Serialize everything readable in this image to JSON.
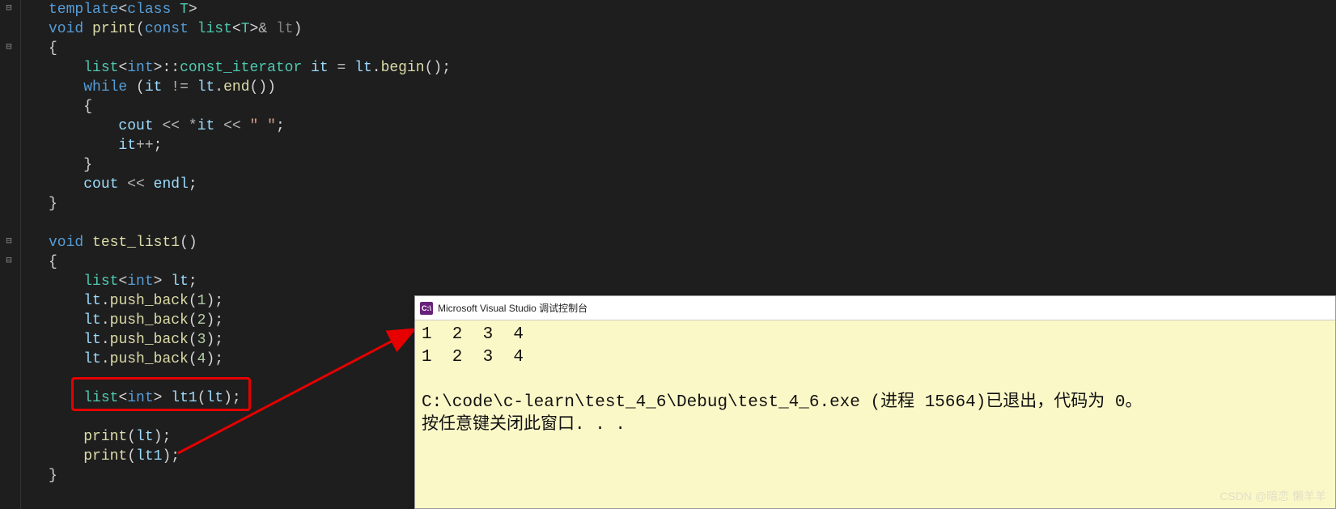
{
  "code": {
    "l1": "template<class T>",
    "l2": "void print(const list<T>& lt)",
    "l3": "{",
    "l4": "    list<int>::const_iterator it = lt.begin();",
    "l5": "    while (it != lt.end())",
    "l6": "    {",
    "l7": "        cout << *it << \" \";",
    "l8": "        it++;",
    "l9": "    }",
    "l10": "    cout << endl;",
    "l11": "}",
    "l12": "",
    "l13": "void test_list1()",
    "l14": "{",
    "l15": "    list<int> lt;",
    "l16": "    lt.push_back(1);",
    "l17": "    lt.push_back(2);",
    "l18": "    lt.push_back(3);",
    "l19": "    lt.push_back(4);",
    "l20": "",
    "l21": "    list<int> lt1(lt);",
    "l22": "",
    "l23": "    print(lt);",
    "l24": "    print(lt1);",
    "l25": "}"
  },
  "console": {
    "title": "Microsoft Visual Studio 调试控制台",
    "icon_text": "C:\\",
    "out1": "1  2  3  4",
    "out2": "1  2  3  4",
    "blank": "",
    "exit": "C:\\code\\c-learn\\test_4_6\\Debug\\test_4_6.exe (进程 15664)已退出，代码为 0。",
    "prompt": "按任意键关闭此窗口. . ."
  },
  "watermark": "CSDN @暗恋 懒羊羊"
}
